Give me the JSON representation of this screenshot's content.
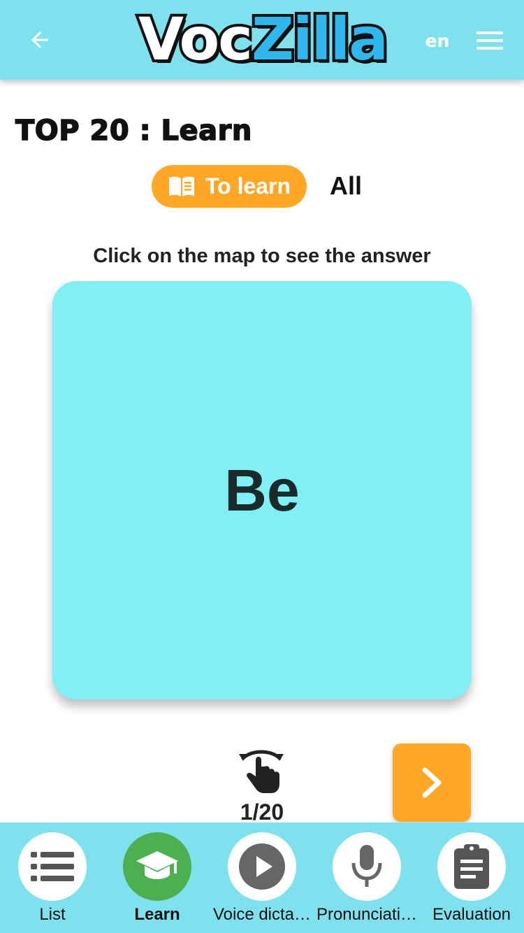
{
  "header": {
    "logo_voc": "Voc",
    "logo_zilla": "Zilla",
    "language": "en",
    "back_icon": "arrow-left-icon",
    "menu_icon": "hamburger-menu-icon"
  },
  "page": {
    "title": "TOP 20 : Learn"
  },
  "filters": {
    "to_learn_label": "To learn",
    "to_learn_icon": "open-book-icon",
    "all_label": "All",
    "active": "To learn"
  },
  "instruction": "Click on the map to see the answer",
  "card": {
    "word": "Be"
  },
  "progress": {
    "counter": "1/20",
    "flip_icon": "tap-flip-icon",
    "next_icon": "chevron-right-icon"
  },
  "bottom_nav": {
    "items": [
      {
        "label": "List",
        "icon": "list-icon",
        "active": false
      },
      {
        "label": "Learn",
        "icon": "graduation-cap-icon",
        "active": true
      },
      {
        "label": "Voice dicta…",
        "icon": "play-icon",
        "active": false
      },
      {
        "label": "Pronunciati…",
        "icon": "microphone-icon",
        "active": false
      },
      {
        "label": "Evaluation",
        "icon": "clipboard-icon",
        "active": false
      }
    ]
  },
  "colors": {
    "header_bg": "#7fe0ee",
    "card_bg": "#80eff6",
    "accent_orange": "#ffa726",
    "active_green": "#4caf50",
    "logo_blue": "#2fb7ee"
  }
}
